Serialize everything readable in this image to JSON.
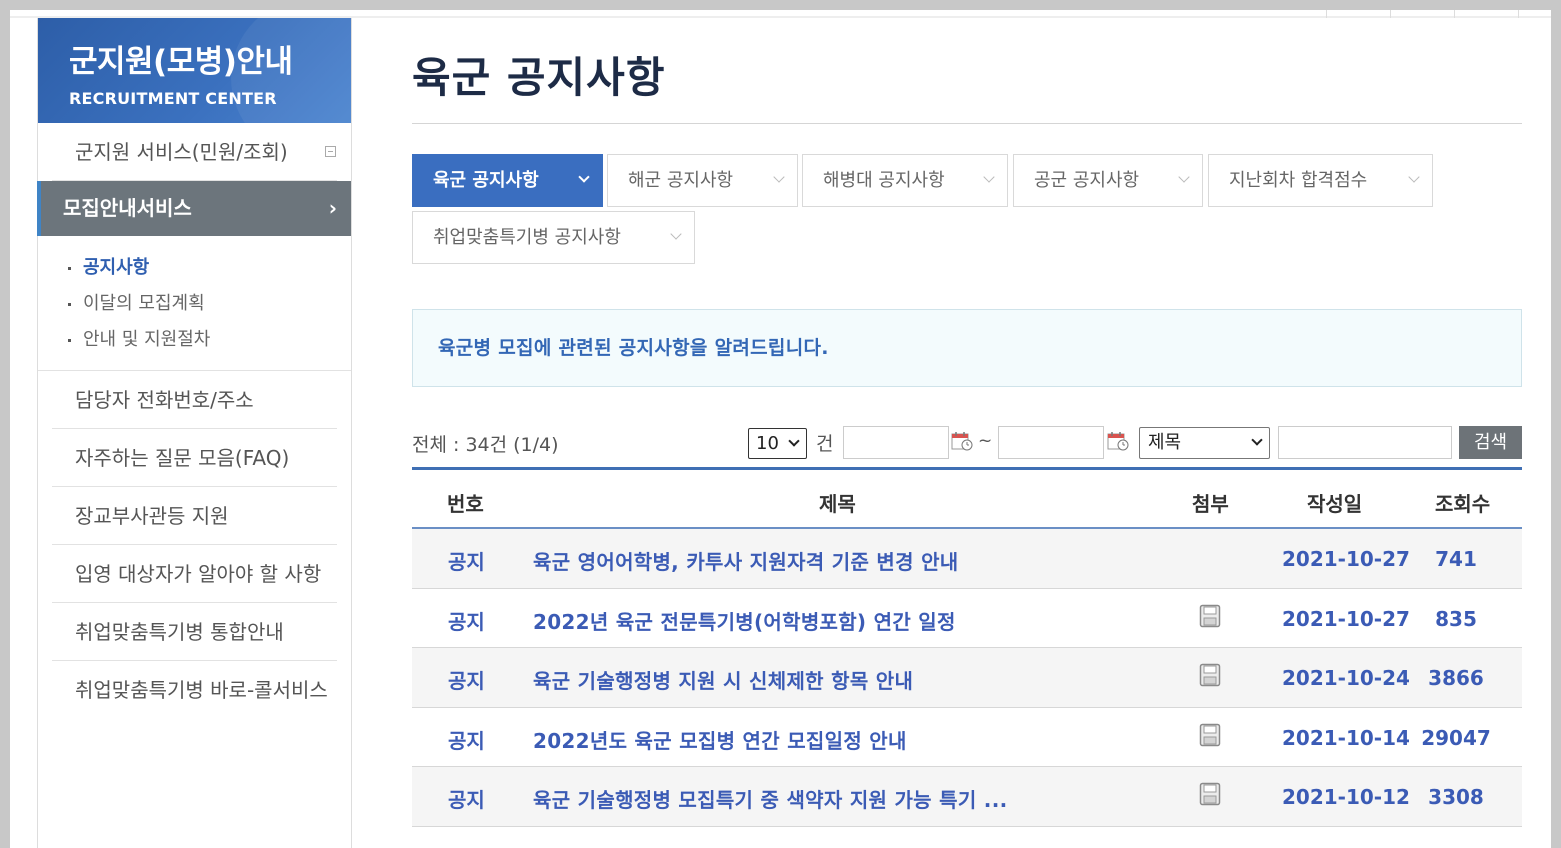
{
  "sidebar": {
    "title": "군지원(모병)안내",
    "subtitle": "RECRUITMENT CENTER",
    "menu_top": "군지원 서비스(민원/조회)",
    "active": "모집안내서비스",
    "active_chevron": "›",
    "sub_items": [
      "공지사항",
      "이달의 모집계획",
      "안내 및 지원절차"
    ],
    "items": [
      "담당자 전화번호/주소",
      "자주하는 질문 모음(FAQ)",
      "장교부사관등 지원",
      "입영 대상자가 알아야 할 사항",
      "취업맞춤특기병 통합안내",
      "취업맞춤특기병 바로-콜서비스"
    ]
  },
  "main": {
    "title": "육군 공지사항",
    "tabs": [
      "육군 공지사항",
      "해군 공지사항",
      "해병대 공지사항",
      "공군 공지사항",
      "지난회차 합격점수",
      "취업맞춤특기병 공지사항"
    ],
    "notice": "육군병 모집에 관련된 공지사항을 알려드립니다."
  },
  "toolbar": {
    "total": "전체 : 34건 (1/4)",
    "per_page": "10",
    "unit": "건",
    "tilde": "~",
    "field": "제목",
    "search_label": "검색"
  },
  "board": {
    "headers": [
      "번호",
      "제목",
      "첨부",
      "작성일",
      "조회수"
    ],
    "rows": [
      {
        "no": "공지",
        "title": "육군 영어어학병, 카투사 지원자격 기준 변경 안내",
        "attach": false,
        "date": "2021-10-27",
        "views": "741"
      },
      {
        "no": "공지",
        "title": "2022년 육군 전문특기병(어학병포함) 연간 일정",
        "attach": true,
        "date": "2021-10-27",
        "views": "835"
      },
      {
        "no": "공지",
        "title": "육군 기술행정병 지원 시 신체제한 항목 안내",
        "attach": true,
        "date": "2021-10-24",
        "views": "3866"
      },
      {
        "no": "공지",
        "title": "2022년도 육군 모집병 연간 모집일정 안내",
        "attach": true,
        "date": "2021-10-14",
        "views": "29047"
      },
      {
        "no": "공지",
        "title": "육군 기술행정병 모집특기 중 색약자 지원 가능 특기 ...",
        "attach": true,
        "date": "2021-10-12",
        "views": "3308"
      }
    ]
  },
  "colors": {
    "accent": "#3a6ec0",
    "link": "#3b5bb5",
    "sidebar_active": "#6c757c"
  }
}
